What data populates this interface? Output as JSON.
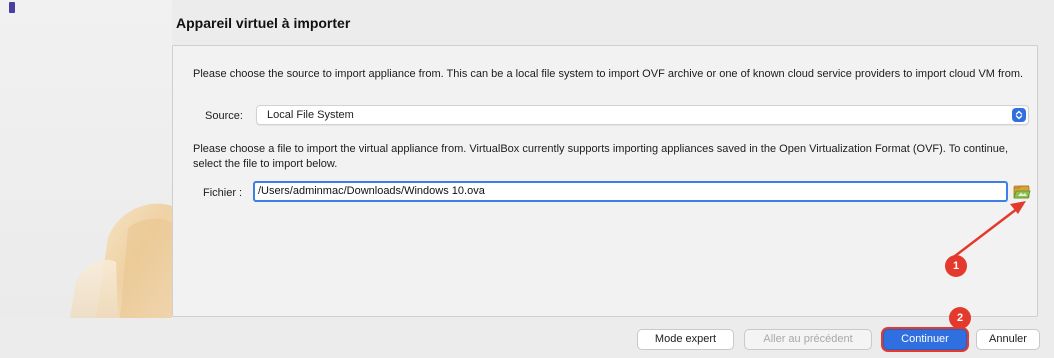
{
  "dialog": {
    "title": "Appareil virtuel à importer"
  },
  "source_section": {
    "intro": "Please choose the source to import appliance from. This can be a local file system to import OVF archive or one of known cloud service providers to import cloud VM from.",
    "label": "Source:",
    "selected": "Local File System"
  },
  "file_section": {
    "intro": "Please choose a file to import the virtual appliance from. VirtualBox currently supports importing appliances saved in the Open Virtualization Format (OVF). To continue, select the file to import below.",
    "label": "Fichier :",
    "path": "/Users/adminmac/Downloads/Windows 10.ova",
    "browse_icon": "folder-open-icon"
  },
  "annotations": {
    "step1": "1",
    "step2": "2",
    "color": "#e43a2d"
  },
  "buttons": {
    "expert": "Mode expert",
    "previous": "Aller au précédent",
    "continue": "Continuer",
    "cancel": "Annuler"
  },
  "colors": {
    "accent": "#2f6fe0",
    "annotation": "#e43a2d"
  }
}
